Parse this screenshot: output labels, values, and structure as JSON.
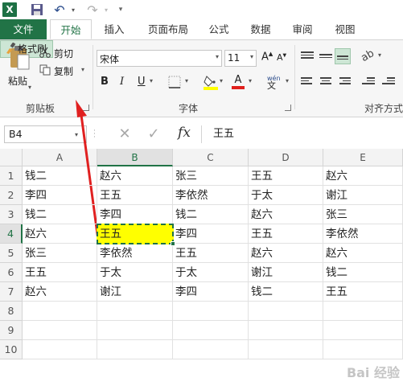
{
  "qat": {
    "excel_icon": "X"
  },
  "tabs": [
    "文件",
    "开始",
    "插入",
    "页面布局",
    "公式",
    "数据",
    "审阅",
    "视图"
  ],
  "clipboard": {
    "paste": "粘贴",
    "cut": "剪切",
    "copy": "复制",
    "format_painter": "格式刷",
    "group": "剪贴板"
  },
  "font": {
    "name": "宋体",
    "size": "11",
    "group": "字体",
    "wen": "wén",
    "wen_char": "文",
    "highlight_color": "#ffff00",
    "font_color": "#e0201c"
  },
  "alignment": {
    "group": "对齐方式"
  },
  "formula_bar": {
    "name_box": "B4",
    "fx": "fx",
    "value": "王五"
  },
  "columns": [
    "A",
    "B",
    "C",
    "D",
    "E"
  ],
  "selected_column": "B",
  "rows": [
    {
      "n": "1",
      "cells": [
        "钱二",
        "赵六",
        "张三",
        "王五",
        "赵六"
      ]
    },
    {
      "n": "2",
      "cells": [
        "李四",
        "王五",
        "李依然",
        "于太",
        "谢江"
      ]
    },
    {
      "n": "3",
      "cells": [
        "钱二",
        "李四",
        "钱二",
        "赵六",
        "张三"
      ]
    },
    {
      "n": "4",
      "cells": [
        "赵六",
        "王五",
        "李四",
        "王五",
        "李依然"
      ]
    },
    {
      "n": "5",
      "cells": [
        "张三",
        "李依然",
        "王五",
        "赵六",
        "赵六"
      ]
    },
    {
      "n": "6",
      "cells": [
        "王五",
        "于太",
        "于太",
        "谢江",
        "钱二"
      ]
    },
    {
      "n": "7",
      "cells": [
        "赵六",
        "谢江",
        "李四",
        "钱二",
        "王五"
      ]
    },
    {
      "n": "8",
      "cells": [
        "",
        "",
        "",
        "",
        ""
      ]
    },
    {
      "n": "9",
      "cells": [
        "",
        "",
        "",
        "",
        ""
      ]
    },
    {
      "n": "10",
      "cells": [
        "",
        "",
        "",
        "",
        ""
      ]
    }
  ],
  "selected_cell": {
    "row": 4,
    "col": 1,
    "fill": "#ffff00"
  },
  "annotation": {
    "arrow_color": "#e02020"
  },
  "watermark": "Bai 经验"
}
